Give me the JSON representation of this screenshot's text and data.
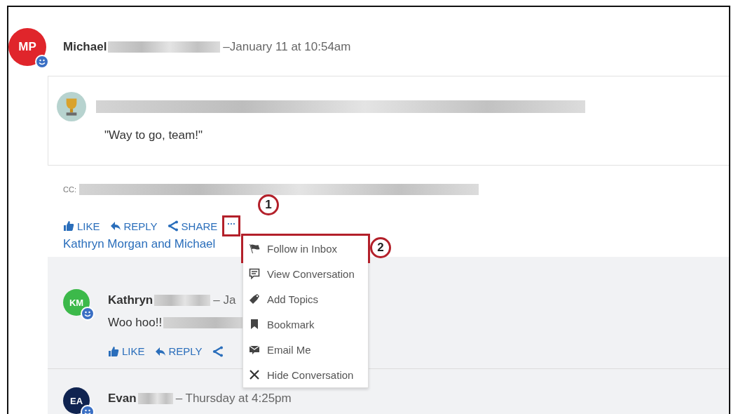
{
  "post": {
    "avatar": {
      "initials": "MP",
      "color": "#e0252b"
    },
    "author": "Michael",
    "timestamp": "–January 11 at 10:54am",
    "quote": "\"Way to go, team!\"",
    "cc_label": "CC:",
    "actions": [
      {
        "kind": "like",
        "label": "LIKE"
      },
      {
        "kind": "reply",
        "label": "REPLY"
      },
      {
        "kind": "share",
        "label": "SHARE"
      },
      {
        "kind": "more",
        "label": "···",
        "callout": "1"
      }
    ],
    "likers": "Kathryn Morgan and Michael"
  },
  "replies": [
    {
      "avatar": {
        "initials": "KM",
        "color": "#3cb94a"
      },
      "author": "Kathryn",
      "timestamp": "– Ja",
      "text": "Woo hoo!!",
      "actions": [
        {
          "kind": "like",
          "label": "LIKE"
        },
        {
          "kind": "reply",
          "label": "REPLY"
        },
        {
          "kind": "share"
        }
      ]
    },
    {
      "avatar": {
        "initials": "EA",
        "color": "#0f2350"
      },
      "author": "Evan",
      "timestamp": "– Thursday at 4:25pm"
    }
  ],
  "menu": [
    {
      "kind": "flag",
      "label": "Follow in Inbox",
      "callout": "2"
    },
    {
      "kind": "comment",
      "label": "View Conversation"
    },
    {
      "kind": "tag",
      "label": "Add Topics"
    },
    {
      "kind": "bookmark",
      "label": "Bookmark"
    },
    {
      "kind": "email",
      "label": "Email Me"
    },
    {
      "kind": "close",
      "label": "Hide Conversation"
    }
  ]
}
